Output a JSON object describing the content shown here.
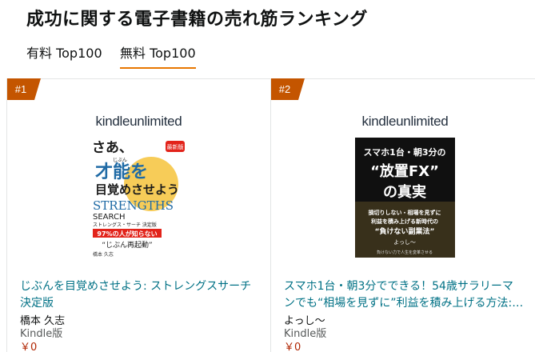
{
  "page": {
    "title": "成功に関する電子書籍の売れ筋ランキング"
  },
  "tabs": [
    {
      "label": "有料 Top100",
      "active": false
    },
    {
      "label": "無料 Top100",
      "active": true
    }
  ],
  "products": [
    {
      "rank": "#1",
      "banner": "kindleunlimited",
      "cover": {
        "line1": "さあ、",
        "ruby": "じぶん",
        "line2": "才能を",
        "line3": "目覚めさせよう",
        "line4": "STRENGTHS",
        "line5": "SEARCH",
        "line6": "ストレングス・サーチ 決定版",
        "badge": "最新版",
        "line7": "97%の人が知らない",
        "line8": "“じぶん再起動”",
        "author": "橋本 久志"
      },
      "title": "じぶんを目覚めさせよう: ストレングスサーチ決定版",
      "author": "橋本 久志",
      "format": "Kindle版",
      "price": "￥0"
    },
    {
      "rank": "#2",
      "banner": "kindleunlimited",
      "cover": {
        "line1": "スマホ1台・朝3分の",
        "line2": "“放置FX”",
        "line3": "の真実",
        "line4": "損切りしない・相場を見ずに",
        "line5": "利益を積み上げる新時代の",
        "line6": "“負けない副業法”",
        "author": "よっし〜",
        "footer": "負けない力で人生を変革させる"
      },
      "title": "スマホ1台・朝3分でできる！54歳サラリーマンでも“相場を見ずに”利益を積み上げる方法:…",
      "author": "よっし〜",
      "format": "Kindle版",
      "price": "￥0"
    }
  ],
  "colors": {
    "accent": "#e77600",
    "badge": "#c45500",
    "link": "#007185",
    "price": "#b12704"
  }
}
